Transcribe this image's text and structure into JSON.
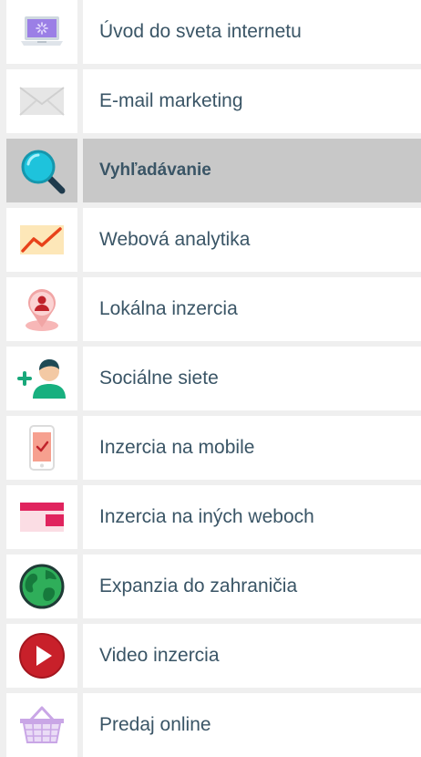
{
  "menu": {
    "items": [
      {
        "label": "Úvod do sveta internetu",
        "icon": "laptop-icon",
        "active": false
      },
      {
        "label": "E-mail marketing",
        "icon": "envelope-icon",
        "active": false
      },
      {
        "label": "Vyhľadávanie",
        "icon": "magnifier-icon",
        "active": true
      },
      {
        "label": "Webová analytika",
        "icon": "chart-icon",
        "active": false
      },
      {
        "label": "Lokálna inzercia",
        "icon": "map-pin-icon",
        "active": false
      },
      {
        "label": "Sociálne siete",
        "icon": "add-person-icon",
        "active": false
      },
      {
        "label": "Inzercia na mobile",
        "icon": "phone-icon",
        "active": false
      },
      {
        "label": "Inzercia na iných weboch",
        "icon": "display-ad-icon",
        "active": false
      },
      {
        "label": "Expanzia do zahraničia",
        "icon": "globe-icon",
        "active": false
      },
      {
        "label": "Video inzercia",
        "icon": "play-icon",
        "active": false
      },
      {
        "label": "Predaj online",
        "icon": "basket-icon",
        "active": false
      }
    ]
  },
  "colors": {
    "label_text": "#3a5566",
    "active_bg": "#c8c8c8",
    "item_bg": "#ffffff",
    "page_bg": "#efefef"
  }
}
